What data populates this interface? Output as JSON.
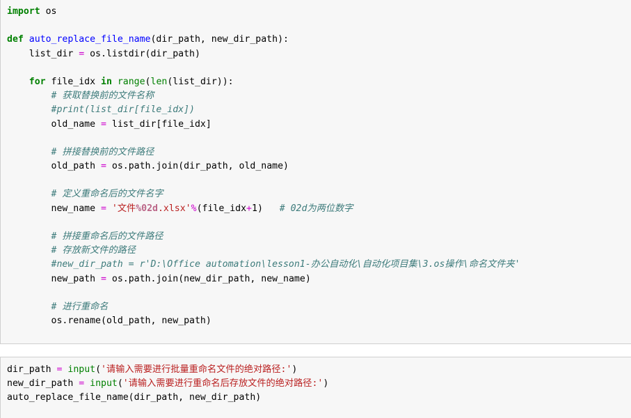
{
  "document": {
    "kind": "jupyter-notebook-code-cells",
    "language": "Python",
    "background_color": "#ffffff",
    "cell_background_color": "#f7f7f7",
    "cell_border_color": "#cfcfcf"
  },
  "syntax_colors": {
    "keyword": "#008000",
    "function_name": "#0000ff",
    "builtin": "#008000",
    "operator": "#cc00cc",
    "string": "#ba2121",
    "comment": "#3d7b7b",
    "string_interpolation": "#bb6688",
    "plain": "#000000"
  },
  "cells": [
    {
      "id": "cell-1",
      "name": "function-definition-cell",
      "lines": [
        {
          "id": "l1",
          "tokens": [
            {
              "t": "k",
              "v": "import"
            },
            {
              "t": "n",
              "v": " os"
            }
          ]
        },
        {
          "id": "l2",
          "tokens": []
        },
        {
          "id": "l3",
          "tokens": [
            {
              "t": "k",
              "v": "def"
            },
            {
              "t": "n",
              "v": " "
            },
            {
              "t": "nf",
              "v": "auto_replace_file_name"
            },
            {
              "t": "p",
              "v": "(dir_path, new_dir_path):"
            }
          ]
        },
        {
          "id": "l4",
          "tokens": [
            {
              "t": "n",
              "v": "    list_dir "
            },
            {
              "t": "o",
              "v": "="
            },
            {
              "t": "n",
              "v": " os"
            },
            {
              "t": "p",
              "v": "."
            },
            {
              "t": "n",
              "v": "listdir"
            },
            {
              "t": "p",
              "v": "(dir_path)"
            }
          ]
        },
        {
          "id": "l5",
          "tokens": []
        },
        {
          "id": "l6",
          "tokens": [
            {
              "t": "n",
              "v": "    "
            },
            {
              "t": "k",
              "v": "for"
            },
            {
              "t": "n",
              "v": " file_idx "
            },
            {
              "t": "k",
              "v": "in"
            },
            {
              "t": "n",
              "v": " "
            },
            {
              "t": "nb",
              "v": "range"
            },
            {
              "t": "p",
              "v": "("
            },
            {
              "t": "nb",
              "v": "len"
            },
            {
              "t": "p",
              "v": "(list_dir)):"
            }
          ]
        },
        {
          "id": "l7",
          "tokens": [
            {
              "t": "n",
              "v": "        "
            },
            {
              "t": "c",
              "v": "# 获取替换前的文件名称"
            }
          ]
        },
        {
          "id": "l8",
          "tokens": [
            {
              "t": "n",
              "v": "        "
            },
            {
              "t": "c",
              "v": "#print(list_dir[file_idx])"
            }
          ]
        },
        {
          "id": "l9",
          "tokens": [
            {
              "t": "n",
              "v": "        old_name "
            },
            {
              "t": "o",
              "v": "="
            },
            {
              "t": "n",
              "v": " list_dir"
            },
            {
              "t": "p",
              "v": "[file_idx]"
            }
          ]
        },
        {
          "id": "l10",
          "tokens": []
        },
        {
          "id": "l11",
          "tokens": [
            {
              "t": "n",
              "v": "        "
            },
            {
              "t": "c",
              "v": "# 拼接替换前的文件路径"
            }
          ]
        },
        {
          "id": "l12",
          "tokens": [
            {
              "t": "n",
              "v": "        old_path "
            },
            {
              "t": "o",
              "v": "="
            },
            {
              "t": "n",
              "v": " os"
            },
            {
              "t": "p",
              "v": "."
            },
            {
              "t": "n",
              "v": "path"
            },
            {
              "t": "p",
              "v": "."
            },
            {
              "t": "n",
              "v": "join"
            },
            {
              "t": "p",
              "v": "(dir_path, old_name)"
            }
          ]
        },
        {
          "id": "l13",
          "tokens": []
        },
        {
          "id": "l14",
          "tokens": [
            {
              "t": "n",
              "v": "        "
            },
            {
              "t": "c",
              "v": "# 定义重命名后的文件名字"
            }
          ]
        },
        {
          "id": "l15",
          "tokens": [
            {
              "t": "n",
              "v": "        new_name "
            },
            {
              "t": "o",
              "v": "="
            },
            {
              "t": "n",
              "v": " "
            },
            {
              "t": "s",
              "v": "'文件"
            },
            {
              "t": "si",
              "v": "%02d"
            },
            {
              "t": "s",
              "v": ".xlsx'"
            },
            {
              "t": "o",
              "v": "%"
            },
            {
              "t": "p",
              "v": "(file_idx"
            },
            {
              "t": "o",
              "v": "+"
            },
            {
              "t": "p",
              "v": "1)"
            },
            {
              "t": "n",
              "v": "   "
            },
            {
              "t": "c",
              "v": "# 02d为两位数字"
            }
          ]
        },
        {
          "id": "l16",
          "tokens": []
        },
        {
          "id": "l17",
          "tokens": [
            {
              "t": "n",
              "v": "        "
            },
            {
              "t": "c",
              "v": "# 拼接重命名后的文件路径"
            }
          ]
        },
        {
          "id": "l18",
          "tokens": [
            {
              "t": "n",
              "v": "        "
            },
            {
              "t": "c",
              "v": "# 存放新文件的路径"
            }
          ]
        },
        {
          "id": "l19",
          "tokens": [
            {
              "t": "n",
              "v": "        "
            },
            {
              "t": "c",
              "v": "#new_dir_path = r'D:\\Office automation\\lesson1-办公自动化\\自动化项目集\\3.os操作\\命名文件夹'"
            }
          ]
        },
        {
          "id": "l20",
          "tokens": [
            {
              "t": "n",
              "v": "        new_path "
            },
            {
              "t": "o",
              "v": "="
            },
            {
              "t": "n",
              "v": " os"
            },
            {
              "t": "p",
              "v": "."
            },
            {
              "t": "n",
              "v": "path"
            },
            {
              "t": "p",
              "v": "."
            },
            {
              "t": "n",
              "v": "join"
            },
            {
              "t": "p",
              "v": "(new_dir_path, new_name)"
            }
          ]
        },
        {
          "id": "l21",
          "tokens": []
        },
        {
          "id": "l22",
          "tokens": [
            {
              "t": "n",
              "v": "        "
            },
            {
              "t": "c",
              "v": "# 进行重命名"
            }
          ]
        },
        {
          "id": "l23",
          "tokens": [
            {
              "t": "n",
              "v": "        os"
            },
            {
              "t": "p",
              "v": "."
            },
            {
              "t": "n",
              "v": "rename"
            },
            {
              "t": "p",
              "v": "(old_path, new_path)"
            }
          ]
        }
      ]
    },
    {
      "id": "cell-2",
      "name": "function-invocation-cell",
      "lines": [
        {
          "id": "m1",
          "tokens": [
            {
              "t": "n",
              "v": "dir_path "
            },
            {
              "t": "o",
              "v": "="
            },
            {
              "t": "n",
              "v": " "
            },
            {
              "t": "nb",
              "v": "input"
            },
            {
              "t": "p",
              "v": "("
            },
            {
              "t": "s",
              "v": "'请输入需要进行批量重命名文件的绝对路径:'"
            },
            {
              "t": "p",
              "v": ")"
            }
          ]
        },
        {
          "id": "m2",
          "tokens": [
            {
              "t": "n",
              "v": "new_dir_path "
            },
            {
              "t": "o",
              "v": "="
            },
            {
              "t": "n",
              "v": " "
            },
            {
              "t": "nb",
              "v": "input"
            },
            {
              "t": "p",
              "v": "("
            },
            {
              "t": "s",
              "v": "'请输入需要进行重命名后存放文件的绝对路径:'"
            },
            {
              "t": "p",
              "v": ")"
            }
          ]
        },
        {
          "id": "m3",
          "tokens": [
            {
              "t": "n",
              "v": "auto_replace_file_name"
            },
            {
              "t": "p",
              "v": "(dir_path, new_dir_path)"
            }
          ]
        }
      ]
    }
  ]
}
